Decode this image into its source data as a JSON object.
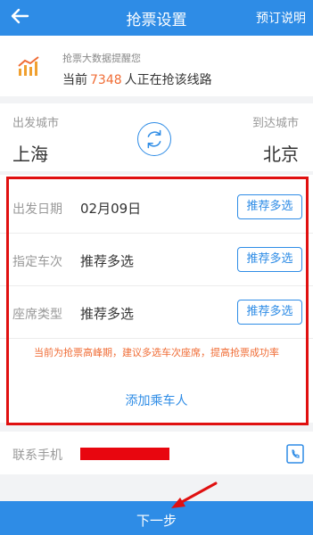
{
  "header": {
    "title": "抢票设置",
    "help": "预订说明"
  },
  "notice": {
    "line1": "抢票大数据提醒您",
    "prefix": "当前",
    "count": "7348",
    "suffix": "人正在抢该线路"
  },
  "route": {
    "from_label": "出发城市",
    "from_city": "上海",
    "to_label": "到达城市",
    "to_city": "北京"
  },
  "date": {
    "label": "出发日期",
    "value": "02月09日",
    "button": "推荐多选"
  },
  "train": {
    "label": "指定车次",
    "value": "推荐多选",
    "button": "推荐多选"
  },
  "seat": {
    "label": "座席类型",
    "value": "推荐多选",
    "button": "推荐多选"
  },
  "warning": "当前为抢票高峰期，建议多选车次座席，提高抢票成功率",
  "add_passenger": "添加乘车人",
  "phone": {
    "label": "联系手机"
  },
  "next_button": "下一步",
  "colors": {
    "primary": "#2e8ce6",
    "accent": "#f06c35",
    "annotation": "#e01010"
  }
}
